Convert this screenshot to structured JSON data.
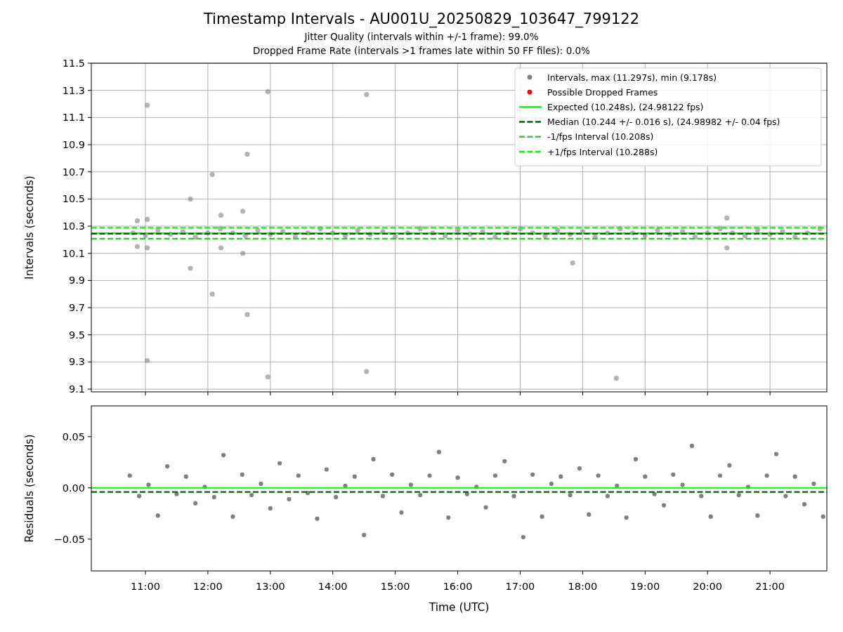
{
  "figure": {
    "title": "Timestamp Intervals - AU001U_20250829_103647_799122",
    "subtitles": [
      "Jitter Quality (intervals within +/-1 frame): 99.0%",
      "Dropped Frame Rate (intervals >1 frames late within 50 FF files): 0.0%"
    ]
  },
  "intervals_plot": {
    "chart_data": {
      "type": "scatter",
      "ylabel": "Intervals (seconds)",
      "xlim": [
        10.134,
        21.91
      ],
      "ylim": [
        9.08,
        11.5
      ],
      "yticks": [
        {
          "value": 9.1,
          "label": "9.1"
        },
        {
          "value": 9.3,
          "label": "9.3"
        },
        {
          "value": 9.5,
          "label": "9.5"
        },
        {
          "value": 9.7,
          "label": "9.7"
        },
        {
          "value": 9.9,
          "label": "9.9"
        },
        {
          "value": 10.1,
          "label": "10.1"
        },
        {
          "value": 10.3,
          "label": "10.3"
        },
        {
          "value": 10.5,
          "label": "10.5"
        },
        {
          "value": 10.7,
          "label": "10.7"
        },
        {
          "value": 10.9,
          "label": "10.9"
        },
        {
          "value": 11.1,
          "label": "11.1"
        },
        {
          "value": 11.3,
          "label": "11.3"
        },
        {
          "value": 11.5,
          "label": "11.5"
        }
      ],
      "series": [
        {
          "name": "Intervals, max (11.297s), min (9.178s)",
          "color": "#808080",
          "x": [
            10.87,
            10.87,
            11.03,
            11.03,
            11.03,
            11.03,
            11.72,
            11.72,
            12.07,
            12.07,
            12.21,
            12.21,
            12.56,
            12.56,
            12.63,
            12.63,
            12.96,
            12.96,
            14.54,
            14.54,
            17.84,
            18.54,
            20.31,
            20.31,
            10.8,
            11.0,
            11.2,
            11.4,
            11.6,
            11.8,
            12.0,
            12.2,
            12.4,
            12.6,
            12.8,
            13.0,
            13.2,
            13.4,
            13.6,
            13.8,
            14.0,
            14.2,
            14.4,
            14.6,
            14.8,
            15.0,
            15.2,
            15.4,
            15.6,
            15.8,
            16.0,
            16.2,
            16.4,
            16.6,
            16.8,
            17.0,
            17.2,
            17.4,
            17.6,
            17.8,
            18.0,
            18.2,
            18.4,
            18.6,
            18.8,
            19.0,
            19.2,
            19.4,
            19.6,
            19.8,
            20.0,
            20.2,
            20.4,
            20.6,
            20.8,
            21.0,
            21.2,
            21.4,
            21.6,
            21.8
          ],
          "values": [
            10.34,
            10.15,
            11.19,
            10.35,
            10.14,
            9.31,
            10.5,
            9.99,
            10.68,
            9.8,
            10.38,
            10.14,
            10.41,
            10.1,
            10.83,
            9.65,
            11.29,
            9.19,
            11.27,
            9.23,
            10.03,
            9.18,
            10.36,
            10.14,
            10.25,
            10.23,
            10.27,
            10.24,
            10.26,
            10.22,
            10.25,
            10.28,
            10.25,
            10.23,
            10.27,
            10.24,
            10.26,
            10.22,
            10.25,
            10.28,
            10.25,
            10.23,
            10.27,
            10.24,
            10.26,
            10.22,
            10.25,
            10.28,
            10.25,
            10.23,
            10.27,
            10.24,
            10.26,
            10.22,
            10.25,
            10.28,
            10.25,
            10.23,
            10.27,
            10.24,
            10.26,
            10.22,
            10.25,
            10.28,
            10.25,
            10.23,
            10.27,
            10.24,
            10.26,
            10.22,
            10.25,
            10.28,
            10.25,
            10.23,
            10.27,
            10.24,
            10.26,
            10.22,
            10.25,
            10.28
          ]
        },
        {
          "name": "Possible Dropped Frames",
          "color": "#ff0000"
        },
        {
          "name": "Expected (10.248s), (24.98122 fps)",
          "color": "#00ff00",
          "type": "line",
          "line_style": "solid",
          "x": [
            10.134,
            21.91
          ],
          "values": [
            10.248,
            10.248
          ]
        },
        {
          "name": "Median (10.244 +/- 0.016 s), (24.98982 +/- 0.04 fps)",
          "color": "#006400",
          "type": "line",
          "line_style": "dashed",
          "x": [
            10.134,
            21.91
          ],
          "values": [
            10.244,
            10.244
          ]
        },
        {
          "name": "-1/fps Interval (10.208s)",
          "color": "#32cd32",
          "type": "line",
          "line_style": "dashed",
          "x": [
            10.134,
            21.91
          ],
          "values": [
            10.208,
            10.208
          ]
        },
        {
          "name": "+1/fps Interval (10.288s)",
          "color": "#00ff00",
          "type": "line",
          "line_style": "dashed",
          "x": [
            10.134,
            21.91
          ],
          "values": [
            10.288,
            10.288
          ]
        }
      ],
      "grid": true,
      "legend": "upper right"
    }
  },
  "residuals_plot": {
    "chart_data": {
      "type": "scatter",
      "xlabel": "Time (UTC)",
      "ylabel": "Residuals (seconds)",
      "xlim": [
        10.134,
        21.91
      ],
      "ylim": [
        -0.081,
        0.08
      ],
      "xticks": [
        {
          "value": 11,
          "label": "11:00"
        },
        {
          "value": 12,
          "label": "12:00"
        },
        {
          "value": 13,
          "label": "13:00"
        },
        {
          "value": 14,
          "label": "14:00"
        },
        {
          "value": 15,
          "label": "15:00"
        },
        {
          "value": 16,
          "label": "16:00"
        },
        {
          "value": 17,
          "label": "17:00"
        },
        {
          "value": 18,
          "label": "18:00"
        },
        {
          "value": 19,
          "label": "19:00"
        },
        {
          "value": 20,
          "label": "20:00"
        },
        {
          "value": 21,
          "label": "21:00"
        }
      ],
      "yticks": [
        {
          "value": -0.05,
          "label": "−0.05"
        },
        {
          "value": 0,
          "label": "0.00"
        },
        {
          "value": 0.05,
          "label": "0.05"
        }
      ],
      "series": [
        {
          "color": "#808080",
          "x": [
            10.75,
            10.9,
            11.05,
            11.2,
            11.35,
            11.5,
            11.65,
            11.8,
            11.95,
            12.1,
            12.25,
            12.4,
            12.55,
            12.7,
            12.85,
            13.0,
            13.15,
            13.3,
            13.45,
            13.6,
            13.75,
            13.9,
            14.05,
            14.2,
            14.35,
            14.5,
            14.65,
            14.8,
            14.95,
            15.1,
            15.25,
            15.4,
            15.55,
            15.7,
            15.85,
            16.0,
            16.15,
            16.3,
            16.45,
            16.6,
            16.75,
            16.9,
            17.05,
            17.2,
            17.35,
            17.5,
            17.65,
            17.8,
            17.95,
            18.1,
            18.25,
            18.4,
            18.55,
            18.7,
            18.85,
            19.0,
            19.15,
            19.3,
            19.45,
            19.6,
            19.75,
            19.9,
            20.05,
            20.2,
            20.35,
            20.5,
            20.65,
            20.8,
            20.95,
            21.1,
            21.25,
            21.4,
            21.55,
            21.7,
            21.85
          ],
          "values": [
            0.012,
            -0.008,
            0.003,
            -0.027,
            0.021,
            -0.006,
            0.011,
            -0.015,
            0.001,
            -0.009,
            0.032,
            -0.028,
            0.013,
            -0.007,
            0.004,
            -0.02,
            0.024,
            -0.011,
            0.012,
            -0.005,
            -0.03,
            0.018,
            -0.009,
            0.002,
            0.011,
            -0.046,
            0.028,
            -0.008,
            0.013,
            -0.024,
            0.003,
            -0.007,
            0.012,
            0.035,
            -0.029,
            0.01,
            -0.006,
            0.001,
            -0.019,
            0.012,
            0.026,
            -0.008,
            -0.048,
            0.013,
            -0.028,
            0.004,
            0.011,
            -0.007,
            0.019,
            -0.026,
            0.012,
            -0.008,
            0.002,
            -0.029,
            0.028,
            0.011,
            -0.006,
            -0.017,
            0.013,
            0.003,
            0.041,
            -0.008,
            -0.028,
            0.012,
            0.022,
            -0.007,
            0.001,
            -0.027,
            0.012,
            0.033,
            -0.008,
            0.011,
            -0.016,
            0.004,
            -0.028
          ]
        },
        {
          "color": "#00ff00",
          "type": "line",
          "line_style": "solid",
          "x": [
            10.134,
            21.91
          ],
          "values": [
            0,
            0
          ]
        },
        {
          "color": "#006400",
          "type": "line",
          "line_style": "dashed",
          "x": [
            10.134,
            21.91
          ],
          "values": [
            -0.004,
            -0.004
          ]
        }
      ],
      "grid": false
    }
  }
}
